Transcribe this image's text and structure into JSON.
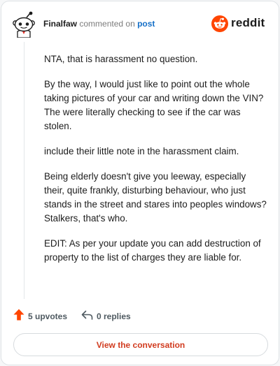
{
  "comment": {
    "author": "Finalfaw",
    "action_text": "commented on",
    "target_link": "post",
    "paragraphs": [
      "NTA, that is harassment no question.",
      "By the way, I would just like to point out the whole taking pictures of your car and writing down the VIN? The were literally checking to see if the car was stolen.",
      "include their little note in the harassment claim.",
      "Being elderly doesn't give you leeway, especially their, quite frankly, disturbing behaviour, who just stands in the street and stares into peoples windows? Stalkers, that's who.",
      "EDIT: As per your update you can add destruction of property to the list of charges they are liable for."
    ]
  },
  "brand": {
    "wordmark": "reddit",
    "color": "#ff4500"
  },
  "footer": {
    "upvotes_label": "5 upvotes",
    "replies_label": "0 replies",
    "upvote_icon": "upvote-arrow-icon",
    "reply_icon": "reply-arrow-icon",
    "upvote_color": "#ff4500"
  },
  "cta": {
    "label": "View the conversation",
    "color": "#d13b1f"
  },
  "icons": {
    "avatar": "snoo-avatar-icon",
    "logo": "reddit-logo-icon"
  }
}
